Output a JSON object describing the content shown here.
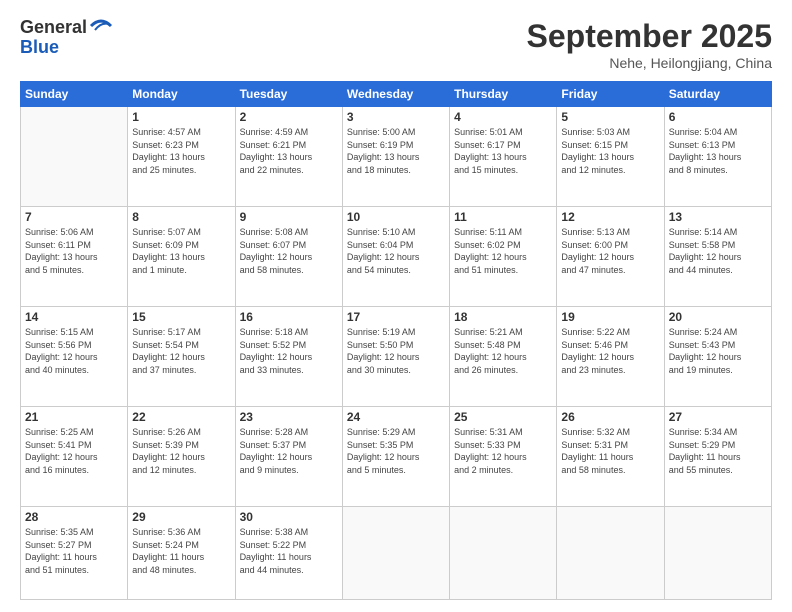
{
  "logo": {
    "general": "General",
    "blue": "Blue"
  },
  "title": "September 2025",
  "location": "Nehe, Heilongjiang, China",
  "days_of_week": [
    "Sunday",
    "Monday",
    "Tuesday",
    "Wednesday",
    "Thursday",
    "Friday",
    "Saturday"
  ],
  "weeks": [
    [
      {
        "day": "",
        "info": ""
      },
      {
        "day": "1",
        "info": "Sunrise: 4:57 AM\nSunset: 6:23 PM\nDaylight: 13 hours\nand 25 minutes."
      },
      {
        "day": "2",
        "info": "Sunrise: 4:59 AM\nSunset: 6:21 PM\nDaylight: 13 hours\nand 22 minutes."
      },
      {
        "day": "3",
        "info": "Sunrise: 5:00 AM\nSunset: 6:19 PM\nDaylight: 13 hours\nand 18 minutes."
      },
      {
        "day": "4",
        "info": "Sunrise: 5:01 AM\nSunset: 6:17 PM\nDaylight: 13 hours\nand 15 minutes."
      },
      {
        "day": "5",
        "info": "Sunrise: 5:03 AM\nSunset: 6:15 PM\nDaylight: 13 hours\nand 12 minutes."
      },
      {
        "day": "6",
        "info": "Sunrise: 5:04 AM\nSunset: 6:13 PM\nDaylight: 13 hours\nand 8 minutes."
      }
    ],
    [
      {
        "day": "7",
        "info": "Sunrise: 5:06 AM\nSunset: 6:11 PM\nDaylight: 13 hours\nand 5 minutes."
      },
      {
        "day": "8",
        "info": "Sunrise: 5:07 AM\nSunset: 6:09 PM\nDaylight: 13 hours\nand 1 minute."
      },
      {
        "day": "9",
        "info": "Sunrise: 5:08 AM\nSunset: 6:07 PM\nDaylight: 12 hours\nand 58 minutes."
      },
      {
        "day": "10",
        "info": "Sunrise: 5:10 AM\nSunset: 6:04 PM\nDaylight: 12 hours\nand 54 minutes."
      },
      {
        "day": "11",
        "info": "Sunrise: 5:11 AM\nSunset: 6:02 PM\nDaylight: 12 hours\nand 51 minutes."
      },
      {
        "day": "12",
        "info": "Sunrise: 5:13 AM\nSunset: 6:00 PM\nDaylight: 12 hours\nand 47 minutes."
      },
      {
        "day": "13",
        "info": "Sunrise: 5:14 AM\nSunset: 5:58 PM\nDaylight: 12 hours\nand 44 minutes."
      }
    ],
    [
      {
        "day": "14",
        "info": "Sunrise: 5:15 AM\nSunset: 5:56 PM\nDaylight: 12 hours\nand 40 minutes."
      },
      {
        "day": "15",
        "info": "Sunrise: 5:17 AM\nSunset: 5:54 PM\nDaylight: 12 hours\nand 37 minutes."
      },
      {
        "day": "16",
        "info": "Sunrise: 5:18 AM\nSunset: 5:52 PM\nDaylight: 12 hours\nand 33 minutes."
      },
      {
        "day": "17",
        "info": "Sunrise: 5:19 AM\nSunset: 5:50 PM\nDaylight: 12 hours\nand 30 minutes."
      },
      {
        "day": "18",
        "info": "Sunrise: 5:21 AM\nSunset: 5:48 PM\nDaylight: 12 hours\nand 26 minutes."
      },
      {
        "day": "19",
        "info": "Sunrise: 5:22 AM\nSunset: 5:46 PM\nDaylight: 12 hours\nand 23 minutes."
      },
      {
        "day": "20",
        "info": "Sunrise: 5:24 AM\nSunset: 5:43 PM\nDaylight: 12 hours\nand 19 minutes."
      }
    ],
    [
      {
        "day": "21",
        "info": "Sunrise: 5:25 AM\nSunset: 5:41 PM\nDaylight: 12 hours\nand 16 minutes."
      },
      {
        "day": "22",
        "info": "Sunrise: 5:26 AM\nSunset: 5:39 PM\nDaylight: 12 hours\nand 12 minutes."
      },
      {
        "day": "23",
        "info": "Sunrise: 5:28 AM\nSunset: 5:37 PM\nDaylight: 12 hours\nand 9 minutes."
      },
      {
        "day": "24",
        "info": "Sunrise: 5:29 AM\nSunset: 5:35 PM\nDaylight: 12 hours\nand 5 minutes."
      },
      {
        "day": "25",
        "info": "Sunrise: 5:31 AM\nSunset: 5:33 PM\nDaylight: 12 hours\nand 2 minutes."
      },
      {
        "day": "26",
        "info": "Sunrise: 5:32 AM\nSunset: 5:31 PM\nDaylight: 11 hours\nand 58 minutes."
      },
      {
        "day": "27",
        "info": "Sunrise: 5:34 AM\nSunset: 5:29 PM\nDaylight: 11 hours\nand 55 minutes."
      }
    ],
    [
      {
        "day": "28",
        "info": "Sunrise: 5:35 AM\nSunset: 5:27 PM\nDaylight: 11 hours\nand 51 minutes."
      },
      {
        "day": "29",
        "info": "Sunrise: 5:36 AM\nSunset: 5:24 PM\nDaylight: 11 hours\nand 48 minutes."
      },
      {
        "day": "30",
        "info": "Sunrise: 5:38 AM\nSunset: 5:22 PM\nDaylight: 11 hours\nand 44 minutes."
      },
      {
        "day": "",
        "info": ""
      },
      {
        "day": "",
        "info": ""
      },
      {
        "day": "",
        "info": ""
      },
      {
        "day": "",
        "info": ""
      }
    ]
  ]
}
